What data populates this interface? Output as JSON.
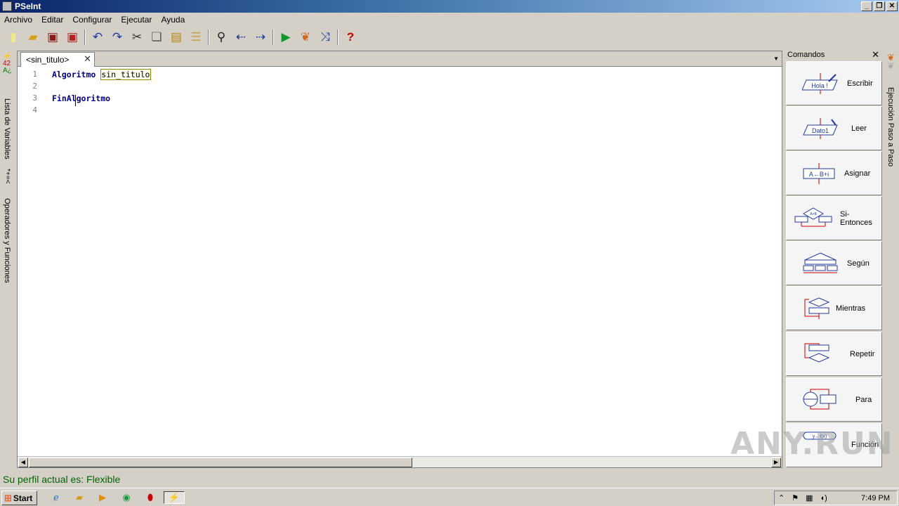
{
  "window": {
    "title": "PSeInt"
  },
  "menu": [
    "Archivo",
    "Editar",
    "Configurar",
    "Ejecutar",
    "Ayuda"
  ],
  "toolbar": {
    "icons": [
      "new-file-icon",
      "open-folder-icon",
      "save-icon",
      "save-as-icon",
      "undo-icon",
      "redo-icon",
      "cut-icon",
      "copy-icon",
      "paste-icon",
      "indent-icon",
      "find-icon",
      "find-previous-icon",
      "find-next-icon",
      "run-icon",
      "step-by-step-icon",
      "draw-flowchart-icon",
      "help-icon"
    ]
  },
  "left_sidebar": {
    "variables_label": "Lista de Variables",
    "operators_label": "Operadores y Funciones"
  },
  "editor": {
    "tab_label": "<sin_titulo>",
    "lines": [
      {
        "num": "1",
        "kw": "Algoritmo",
        "name": "sin_titulo"
      },
      {
        "num": "2",
        "text": ""
      },
      {
        "num": "3",
        "kw": "FinAlgoritmo"
      },
      {
        "num": "4",
        "text": ""
      }
    ]
  },
  "commands": {
    "title": "Comandos",
    "items": [
      {
        "label": "Escribir",
        "icon_text": "Hola !"
      },
      {
        "label": "Leer",
        "icon_text": "Dato1"
      },
      {
        "label": "Asignar",
        "icon_text": "A←B+i"
      },
      {
        "label": "Si-Entonces",
        "icon_text": "A>B"
      },
      {
        "label": "Según",
        "icon_text": ""
      },
      {
        "label": "Mientras",
        "icon_text": ""
      },
      {
        "label": "Repetir",
        "icon_text": ""
      },
      {
        "label": "Para",
        "icon_text": ""
      },
      {
        "label": "Función",
        "icon_text": "y←f(x)"
      }
    ]
  },
  "right_sidebar": {
    "label": "Ejecución Paso a Paso"
  },
  "status": {
    "text": "Su perfil actual es: Flexible"
  },
  "taskbar": {
    "start_label": "Start",
    "clock": "7:49 PM"
  },
  "watermark": "ANY.RUN"
}
